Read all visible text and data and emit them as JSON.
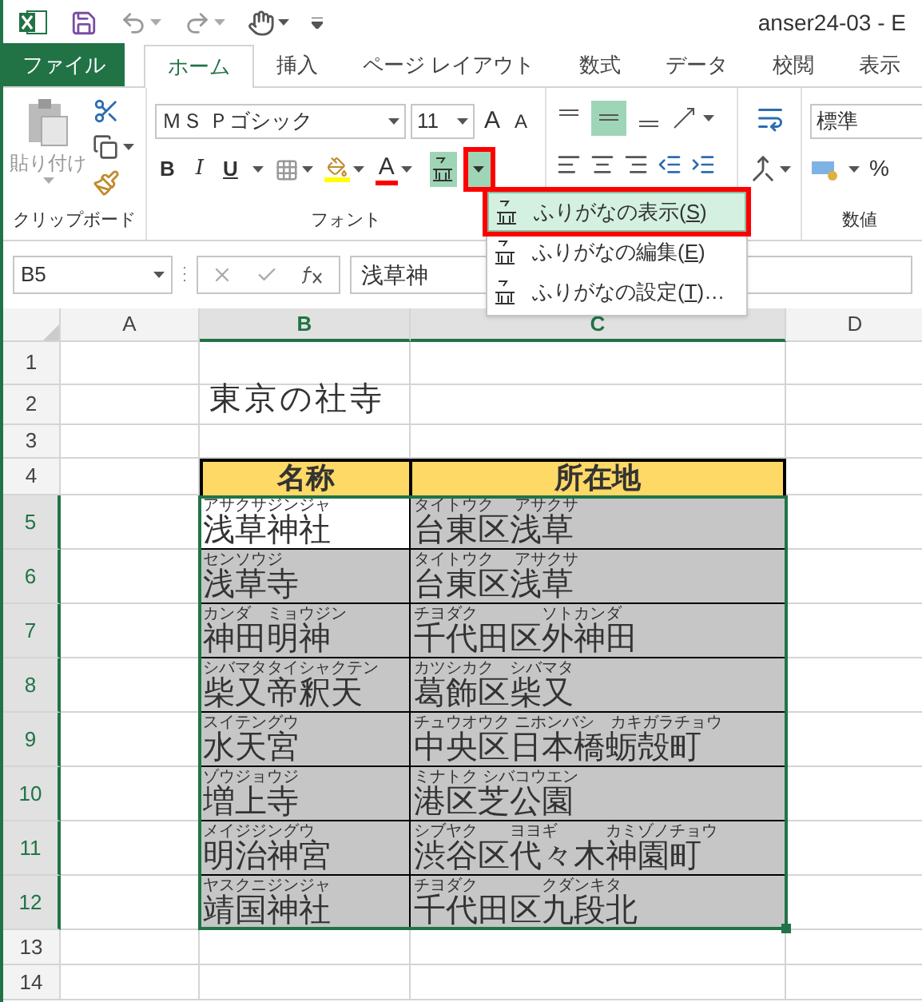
{
  "window": {
    "title": "anser24-03 - E"
  },
  "tabs": [
    {
      "label": "ファイル",
      "kind": "file",
      "selected": false
    },
    {
      "label": "ホーム",
      "kind": "tab",
      "selected": true
    },
    {
      "label": "挿入",
      "kind": "tab",
      "selected": false
    },
    {
      "label": "ページ レイアウト",
      "kind": "tab",
      "selected": false
    },
    {
      "label": "数式",
      "kind": "tab",
      "selected": false
    },
    {
      "label": "データ",
      "kind": "tab",
      "selected": false
    },
    {
      "label": "校閲",
      "kind": "tab",
      "selected": false
    },
    {
      "label": "表示",
      "kind": "tab",
      "selected": false
    }
  ],
  "ribbon": {
    "paste_label": "貼り付け",
    "font_name": "ＭＳ Ｐゴシック",
    "font_size": "11",
    "grow_font": "A",
    "shrink_font": "A",
    "bold": "B",
    "italic": "I",
    "underline": "U",
    "font_color": "A",
    "number_format": "標準",
    "percent": "%",
    "groups": [
      "クリップボード",
      "フォント",
      "数値"
    ]
  },
  "furigana_menu": {
    "items": [
      {
        "label": "ふりがなの表示(",
        "key": "S",
        "suffix": ")",
        "selected": true
      },
      {
        "label": "ふりがなの編集(",
        "key": "E",
        "suffix": ")",
        "selected": false
      },
      {
        "label": "ふりがなの設定(",
        "key": "T",
        "suffix": ")…",
        "selected": false
      }
    ]
  },
  "formula_bar": {
    "name_box": "B5",
    "formula": "浅草神"
  },
  "sheet": {
    "columns": [
      {
        "label": "A",
        "selected": false
      },
      {
        "label": "B",
        "selected": true
      },
      {
        "label": "C",
        "selected": true
      },
      {
        "label": "D",
        "selected": false
      }
    ],
    "title": "東京の社寺",
    "headers": [
      "名称",
      "所在地"
    ],
    "rows": [
      {
        "name": {
          "ruby": "アサクサジンジャ",
          "text": "浅草神社"
        },
        "address": {
          "ruby": "タイトウク　 アサクサ",
          "text": "台東区浅草"
        },
        "active": true
      },
      {
        "name": {
          "ruby": "センソウジ",
          "text": "浅草寺"
        },
        "address": {
          "ruby": "タイトウク　 アサクサ",
          "text": "台東区浅草"
        },
        "active": false
      },
      {
        "name": {
          "ruby": "カンダ　ミョウジン",
          "text": "神田明神"
        },
        "address": {
          "ruby": "チヨダク　　　　ソトカンダ",
          "text": "千代田区外神田"
        },
        "active": false
      },
      {
        "name": {
          "ruby": "シバマタタイシャクテン",
          "text": "柴又帝釈天"
        },
        "address": {
          "ruby": "カツシカク　シバマタ",
          "text": "葛飾区柴又"
        },
        "active": false
      },
      {
        "name": {
          "ruby": "スイテングウ",
          "text": "水天宮"
        },
        "address": {
          "ruby": "チュウオウク ニホンバシ　カキガラチョウ",
          "text": "中央区日本橋蛎殻町"
        },
        "active": false
      },
      {
        "name": {
          "ruby": "ゾウジョウジ",
          "text": "増上寺"
        },
        "address": {
          "ruby": "ミナトク シバコウエン",
          "text": "港区芝公園"
        },
        "active": false
      },
      {
        "name": {
          "ruby": "メイジジングウ",
          "text": "明治神宮"
        },
        "address": {
          "ruby": "シブヤク　　ヨヨギ　　　カミゾノチョウ",
          "text": "渋谷区代々木神園町"
        },
        "active": false
      },
      {
        "name": {
          "ruby": "ヤスクニジンジャ",
          "text": "靖国神社"
        },
        "address": {
          "ruby": "チヨダク　　　　クダンキタ",
          "text": "千代田区九段北"
        },
        "active": false
      }
    ],
    "row_numbers": [
      "1",
      "2",
      "3",
      "4",
      "5",
      "6",
      "7",
      "8",
      "9",
      "10",
      "11",
      "12",
      "13",
      "14"
    ]
  }
}
